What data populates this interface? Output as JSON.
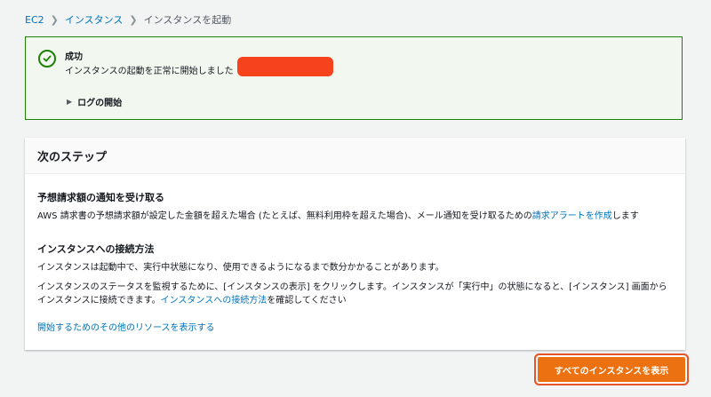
{
  "breadcrumb": {
    "items": [
      "EC2",
      "インスタンス",
      "インスタンスを起動"
    ]
  },
  "flash": {
    "title": "成功",
    "message": "インスタンスの起動を正常に開始しました",
    "log_toggle": "ログの開始"
  },
  "next_steps": {
    "header": "次のステップ",
    "billing": {
      "title": "予想請求額の通知を受け取る",
      "text_before": "AWS 請求書の予想請求額が設定した金額を超えた場合 (たとえば、無料利用枠を超えた場合)、メール通知を受け取るための",
      "link": "請求アラートを作成",
      "text_after": "します"
    },
    "connect": {
      "title": "インスタンスへの接続方法",
      "p1": "インスタンスは起動中で、実行中状態になり、使用できるようになるまで数分かかることがあります。",
      "p2_line1": "インスタンスのステータスを監視するために、[インスタンスの表示] をクリックします。インスタンスが「実行中」の状態になると、[インスタンス] 画面から",
      "p2_line2_before": "インスタンスに接続できます。",
      "p2_link": "インスタンスへの接続方法",
      "p2_line2_after": "を確認してください"
    },
    "more_resources_link": "開始するためのその他のリソースを表示する"
  },
  "actions": {
    "view_all_label": "すべてのインスタンスを表示"
  },
  "colors": {
    "primary": "#ec7211",
    "success": "#1d8102",
    "link": "#0073bb",
    "redaction": "#f6431b"
  }
}
